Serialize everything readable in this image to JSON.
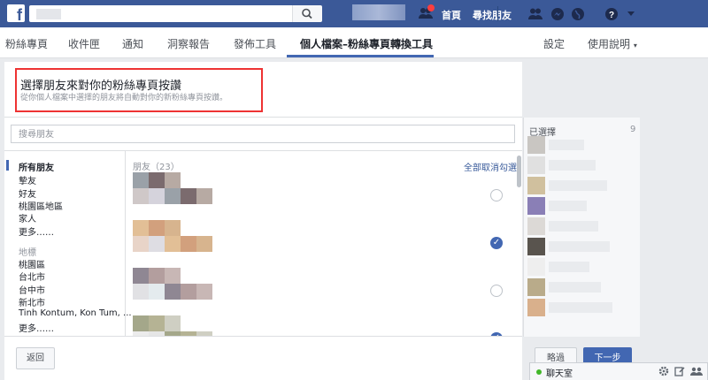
{
  "topbar": {
    "logo": "f",
    "search_placeholder": "",
    "nav_home": "首頁",
    "nav_find_friends": "尋找朋友",
    "icons": [
      "friend-requests-icon",
      "friends-icon",
      "messenger-icon",
      "globe-icon",
      "help-icon",
      "caret-down-icon"
    ],
    "notification_color": "#fa3e3e",
    "bar_color": "#3b5998"
  },
  "subnav": {
    "tabs": [
      "粉絲專頁",
      "收件匣",
      "通知",
      "洞察報告",
      "發佈工具",
      "個人檔案–粉絲專頁轉換工具"
    ],
    "active_tab": "個人檔案–粉絲專頁轉換工具",
    "settings": "設定",
    "help": "使用說明",
    "help_caret": "▾"
  },
  "header": {
    "title": "選擇朋友來對你的粉絲專頁按讚",
    "subtitle": "從你個人檔案中選擇的朋友將自動對你的新粉絲專頁按讚。"
  },
  "search": {
    "placeholder": "搜尋朋友"
  },
  "categories": {
    "group1": [
      "所有朋友",
      "摯友",
      "好友",
      "桃園區地區",
      "家人",
      "更多……"
    ],
    "active": "所有朋友",
    "group2_title": "地標",
    "group2": [
      "桃園區",
      "台北市",
      "台中市",
      "新北市",
      "Tinh Kontum, Kon Tum, ...",
      "更多……"
    ]
  },
  "friends": {
    "label": "朋友（23）",
    "unselect_all": "全部取消勾選",
    "rows": [
      {
        "selected": false,
        "tiles": [
          "#9aa1a8",
          "#7b6b6e",
          "#b7aaa3",
          "#cfc8c8",
          "#d5d3dc"
        ]
      },
      {
        "selected": true,
        "tiles": [
          "#e2bf96",
          "#d2a07d",
          "#d7b48e",
          "#e8d4c8",
          "#dedde3"
        ]
      },
      {
        "selected": false,
        "tiles": [
          "#8f8793",
          "#b39e9e",
          "#c8b7b5",
          "#e1e1e4",
          "#e4ebee"
        ]
      },
      {
        "selected": true,
        "tiles": [
          "#a4a78a",
          "#b5b394",
          "#cfcfc3",
          "#ececec",
          "#e6e6e6"
        ]
      }
    ]
  },
  "selected": {
    "label": "已選擇",
    "count": "9",
    "tiles": [
      "#c9c6c2",
      "#e0e0e0",
      "#d0c09e",
      "#8a7fb6",
      "#dcd9d6",
      "#59544e",
      "#eeeeee",
      "#b9ab8a",
      "#d9b08c"
    ]
  },
  "footer": {
    "back": "返回",
    "skip": "略過",
    "next": "下一步"
  },
  "chat": {
    "label": "聊天室",
    "status_color": "#42b72a"
  }
}
